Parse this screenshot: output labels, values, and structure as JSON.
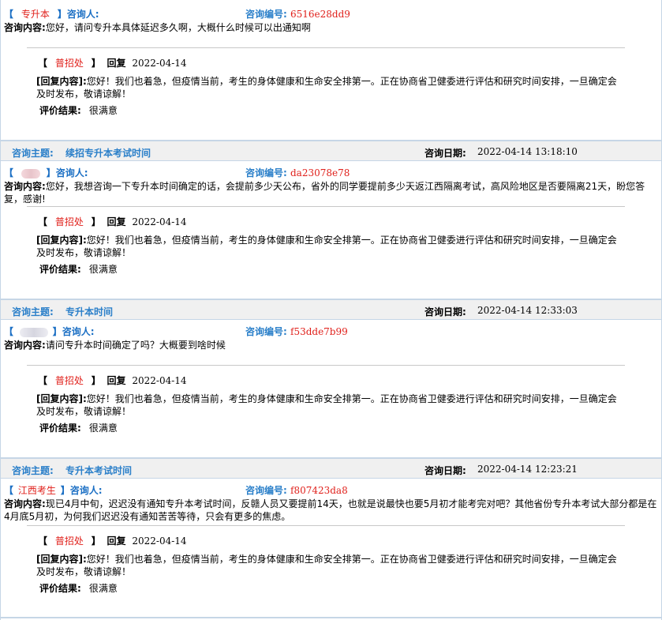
{
  "labels": {
    "topic": "咨询主题:",
    "date": "咨询日期:",
    "asker": "咨询人:",
    "consult_id": "咨询编号:",
    "content": "咨询内容:",
    "reply_dept": "普招处",
    "reply": "回复",
    "reply_content": "[回复内容]:",
    "evaluation": "评价结果:",
    "bracket_open": "【",
    "bracket_close": "】"
  },
  "entries": [
    {
      "topic": "",
      "datetime": "",
      "asker": "专升本",
      "asker_blurred": false,
      "consult_id": "6516e28dd9",
      "content": "您好，请问专升本具体延迟多久啊，大概什么时候可以出通知啊",
      "reply_date": "2022-04-14",
      "reply_text": "您好！我们也着急，但疫情当前，考生的身体健康和生命安全排第一。正在协商省卫健委进行评估和研究时间安排，一旦确定会及时发布，敬请谅解！",
      "evaluation": "很满意"
    },
    {
      "topic": "续招专升本考试时间",
      "datetime": "2022-04-14 13:18:10",
      "asker": "",
      "asker_blurred": true,
      "consult_id": "da23078e78",
      "content": "您好，我想咨询一下专升本时间确定的话，会提前多少天公布，省外的同学要提前多少天返江西隔离考试，高风险地区是否要隔离21天，盼您答复，感谢!",
      "reply_date": "2022-04-14",
      "reply_text": "您好！我们也着急，但疫情当前，考生的身体健康和生命安全排第一。正在协商省卫健委进行评估和研究时间安排，一旦确定会及时发布，敬请谅解！",
      "evaluation": "很满意"
    },
    {
      "topic": "专升本时间",
      "datetime": "2022-04-14 12:33:03",
      "asker": "",
      "asker_blurred": true,
      "consult_id": "f53dde7b99",
      "content": "请问专升本时间确定了吗？大概要到啥时候",
      "reply_date": "2022-04-14",
      "reply_text": "您好！我们也着急，但疫情当前，考生的身体健康和生命安全排第一。正在协商省卫健委进行评估和研究时间安排，一旦确定会及时发布，敬请谅解！",
      "evaluation": "很满意"
    },
    {
      "topic": "专升本考试时间",
      "datetime": "2022-04-14 12:23:21",
      "asker": "江西考生",
      "asker_blurred": false,
      "consult_id": "f807423da8",
      "content": "现已4月中旬，迟迟没有通知专升本考试时间，反赣人员又要提前14天，也就是说最快也要5月初才能考完对吧？其他省份专升本考试大部分都是在4月底5月初，为何我们迟迟没有通知苦苦等待，只会有更多的焦虑。",
      "reply_date": "2022-04-14",
      "reply_text": "您好！我们也着急，但疫情当前，考生的身体健康和生命安全排第一。正在协商省卫健委进行评估和研究时间安排，一旦确定会及时发布，敬请谅解！",
      "evaluation": "很满意"
    }
  ]
}
